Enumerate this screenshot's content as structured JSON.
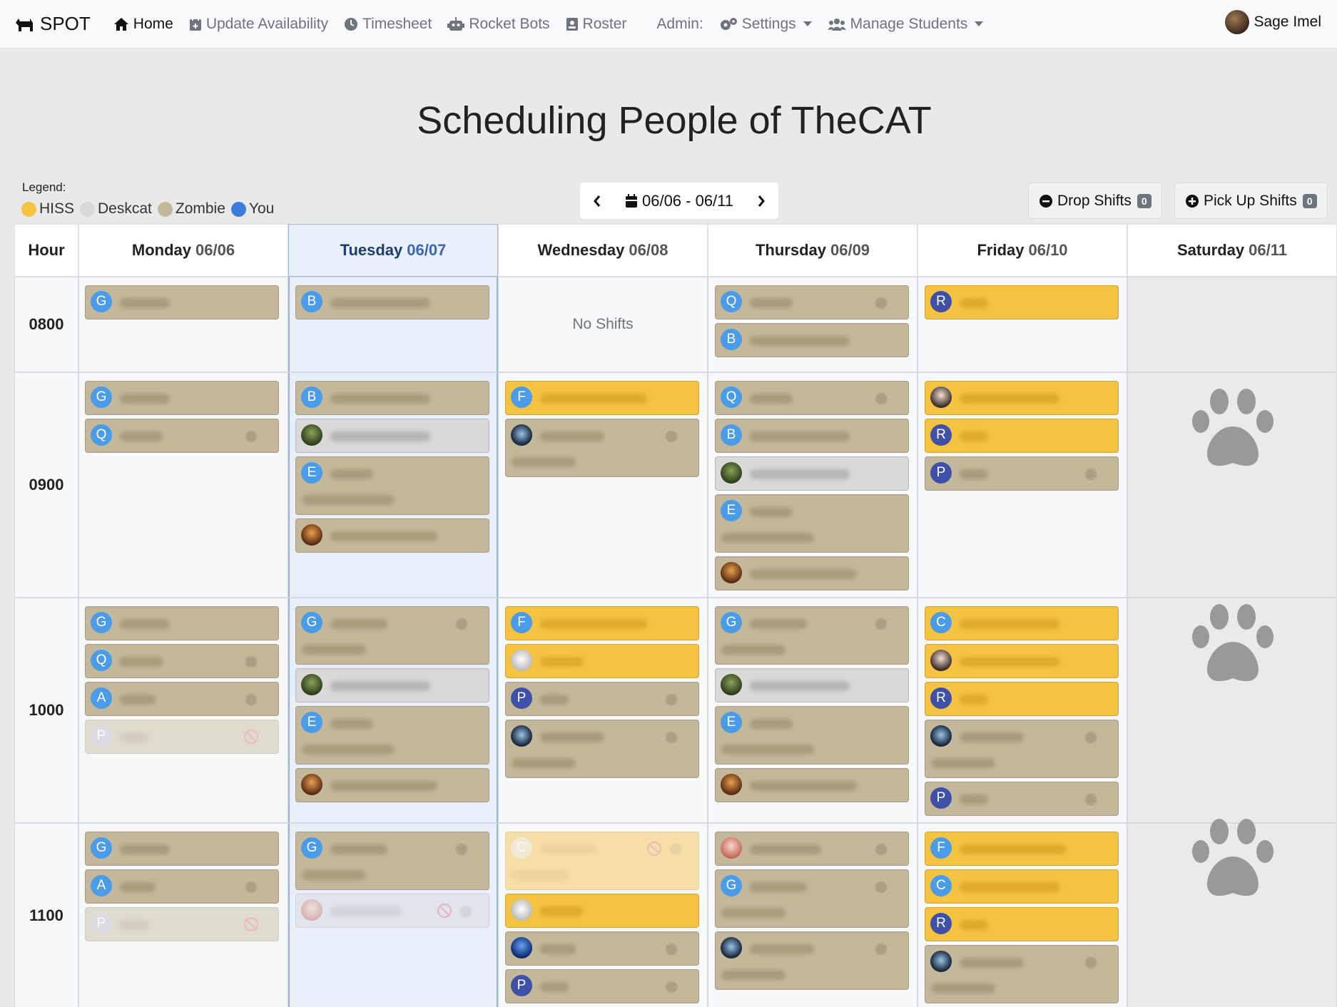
{
  "nav": {
    "brand": "SPOT",
    "items": [
      {
        "label": "Home",
        "icon": "home-icon"
      },
      {
        "label": "Update Availability",
        "icon": "calendar-plus-icon"
      },
      {
        "label": "Timesheet",
        "icon": "clock-icon"
      },
      {
        "label": "Rocket Bots",
        "icon": "robot-icon"
      },
      {
        "label": "Roster",
        "icon": "id-card-icon"
      }
    ],
    "admin_label": "Admin:",
    "settings_label": "Settings",
    "manage_students_label": "Manage Students",
    "user_name": "Sage Imel"
  },
  "page_title": "Scheduling People of TheCAT",
  "legend": {
    "label": "Legend:",
    "items": [
      {
        "label": "HISS",
        "color": "#f5c342"
      },
      {
        "label": "Deskcat",
        "color": "#d9d9d9"
      },
      {
        "label": "Zombie",
        "color": "#c4b89b"
      },
      {
        "label": "You",
        "color": "#3b7ddd"
      }
    ]
  },
  "week_range": "06/06 - 06/11",
  "drop_shifts": {
    "label": "Drop Shifts",
    "count": "0"
  },
  "pick_up_shifts": {
    "label": "Pick Up Shifts",
    "count": "0"
  },
  "table": {
    "hour_header": "Hour",
    "days": [
      {
        "name": "Monday",
        "date": "06/06"
      },
      {
        "name": "Tuesday",
        "date": "06/07"
      },
      {
        "name": "Wednesday",
        "date": "06/08"
      },
      {
        "name": "Thursday",
        "date": "06/09"
      },
      {
        "name": "Friday",
        "date": "06/10"
      },
      {
        "name": "Saturday",
        "date": "06/11"
      }
    ],
    "hours": [
      "0800",
      "0900",
      "1000",
      "1100"
    ],
    "no_shifts": "No Shifts"
  },
  "shift_initials": {
    "g": "G",
    "b": "B",
    "q": "Q",
    "r": "R",
    "f": "F",
    "e": "E",
    "p": "P",
    "a": "A",
    "c": "C"
  },
  "colors": {
    "hiss": "#f5c342",
    "deskcat": "#d9d9d9",
    "zombie": "#c4b89b",
    "you": "#3b7ddd"
  }
}
